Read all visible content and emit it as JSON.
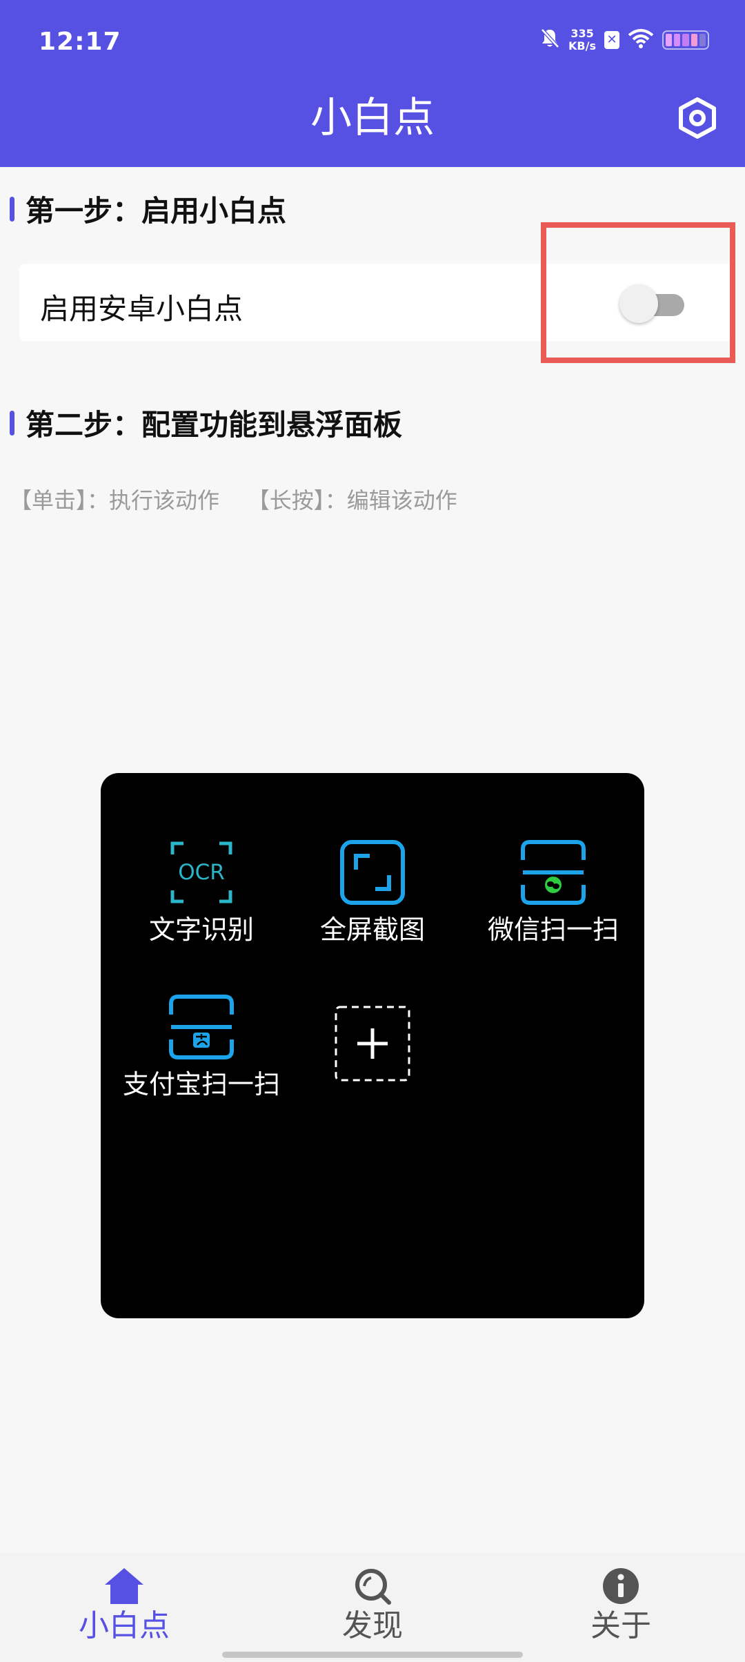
{
  "status_bar": {
    "time": "12:17",
    "net_speed_value": "335",
    "net_speed_unit": "KB/s"
  },
  "header": {
    "title": "小白点",
    "settings_icon": "settings-hex-icon"
  },
  "step1": {
    "title": "第一步：启用小白点",
    "toggle_label": "启用安卓小白点",
    "toggle_on": false
  },
  "step2": {
    "title": "第二步：配置功能到悬浮面板",
    "hint": "【单击】：执行该动作    【长按】：编辑该动作"
  },
  "panel": {
    "items": [
      {
        "label": "文字识别",
        "icon": "ocr-icon"
      },
      {
        "label": "全屏截图",
        "icon": "fullscreen-screenshot-icon"
      },
      {
        "label": "微信扫一扫",
        "icon": "wechat-scan-icon"
      },
      {
        "label": "支付宝扫一扫",
        "icon": "alipay-scan-icon"
      }
    ],
    "add_icon": "add-icon"
  },
  "bottom_nav": {
    "items": [
      {
        "label": "小白点",
        "icon": "home-icon",
        "active": true
      },
      {
        "label": "发现",
        "icon": "discover-search-icon",
        "active": false
      },
      {
        "label": "关于",
        "icon": "info-icon",
        "active": false
      }
    ]
  },
  "colors": {
    "primary": "#5650e3",
    "highlight": "#ea5b55",
    "panel_bg": "#000000",
    "icon_blue": "#1ca3ea",
    "icon_teal": "#2bb5c8"
  }
}
